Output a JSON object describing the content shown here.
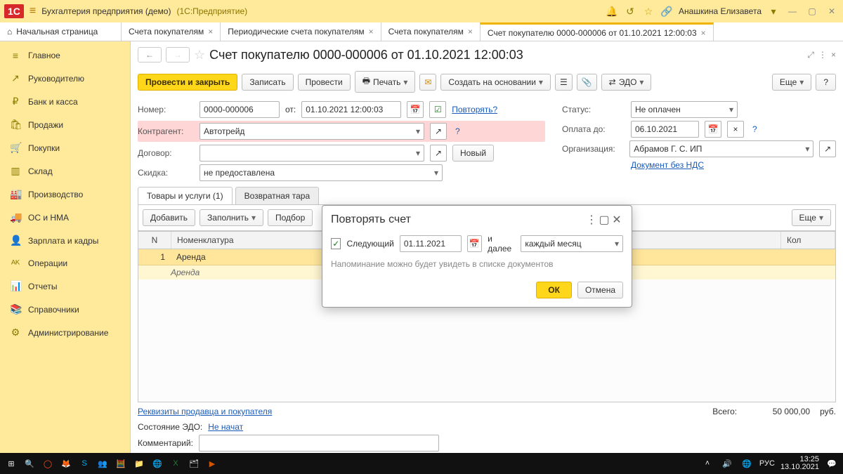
{
  "titlebar": {
    "app": "Бухгалтерия предприятия (демо)",
    "sub": "(1С:Предприятие)",
    "user": "Анашкина Елизавета"
  },
  "tabs": {
    "home": "Начальная страница",
    "items": [
      {
        "label": "Счета покупателям"
      },
      {
        "label": "Периодические счета покупателям"
      },
      {
        "label": "Счета покупателям"
      },
      {
        "label": "Счет покупателю 0000-000006 от 01.10.2021 12:00:03",
        "active": true
      }
    ]
  },
  "sidebar": {
    "items": [
      {
        "icon": "≡",
        "label": "Главное"
      },
      {
        "icon": "↗",
        "label": "Руководителю"
      },
      {
        "icon": "₽",
        "label": "Банк и касса"
      },
      {
        "icon": "🛍",
        "label": "Продажи"
      },
      {
        "icon": "🛒",
        "label": "Покупки"
      },
      {
        "icon": "▥",
        "label": "Склад"
      },
      {
        "icon": "🏭",
        "label": "Производство"
      },
      {
        "icon": "🚚",
        "label": "ОС и НМА"
      },
      {
        "icon": "👤",
        "label": "Зарплата и кадры"
      },
      {
        "icon": "ᴬᴷ",
        "label": "Операции"
      },
      {
        "icon": "📊",
        "label": "Отчеты"
      },
      {
        "icon": "📚",
        "label": "Справочники"
      },
      {
        "icon": "⚙",
        "label": "Администрирование"
      }
    ]
  },
  "header": {
    "title": "Счет покупателю 0000-000006 от 01.10.2021 12:00:03"
  },
  "toolbar": {
    "post_close": "Провести и закрыть",
    "write": "Записать",
    "post": "Провести",
    "print": "Печать",
    "create_basis": "Создать на основании",
    "edo": "ЭДО",
    "more": "Еще",
    "help": "?"
  },
  "form": {
    "num_lbl": "Номер:",
    "num": "0000-000006",
    "from_lbl": "от:",
    "date": "01.10.2021 12:00:03",
    "repeat_link": "Повторять?",
    "status_lbl": "Статус:",
    "status": "Не оплачен",
    "contr_lbl": "Контрагент:",
    "contr": "Автотрейд",
    "pay_lbl": "Оплата до:",
    "pay": "06.10.2021",
    "dog_lbl": "Договор:",
    "new_btn": "Новый",
    "org_lbl": "Организация:",
    "org": "Абрамов Г. С. ИП",
    "disc_lbl": "Скидка:",
    "disc": "не предоставлена",
    "doc_link": "Документ без НДС"
  },
  "tabs2": {
    "t1": "Товары и услуги (1)",
    "t2": "Возвратная тара"
  },
  "tablebar": {
    "add": "Добавить",
    "fill": "Заполнить",
    "pick": "Подбор",
    "more": "Еще"
  },
  "grid": {
    "headN": "N",
    "headNom": "Номенклатура",
    "headKol": "Кол",
    "row": {
      "n": "1",
      "name": "Аренда",
      "sub": "Аренда"
    }
  },
  "footer": {
    "req_link": "Реквизиты продавца и покупателя",
    "total_lbl": "Всего:",
    "total": "50 000,00",
    "cur": "руб.",
    "edo_lbl": "Состояние ЭДО:",
    "edo_val": "Не начат",
    "comment_lbl": "Комментарий:"
  },
  "modal": {
    "title": "Повторять счет",
    "next_lbl": "Следующий",
    "date": "01.11.2021",
    "and": "и далее",
    "period": "каждый месяц",
    "note": "Напоминание можно будет увидеть в списке документов",
    "ok": "ОК",
    "cancel": "Отмена"
  },
  "taskbar": {
    "lang": "РУС",
    "time": "13:25",
    "date": "13.10.2021"
  }
}
